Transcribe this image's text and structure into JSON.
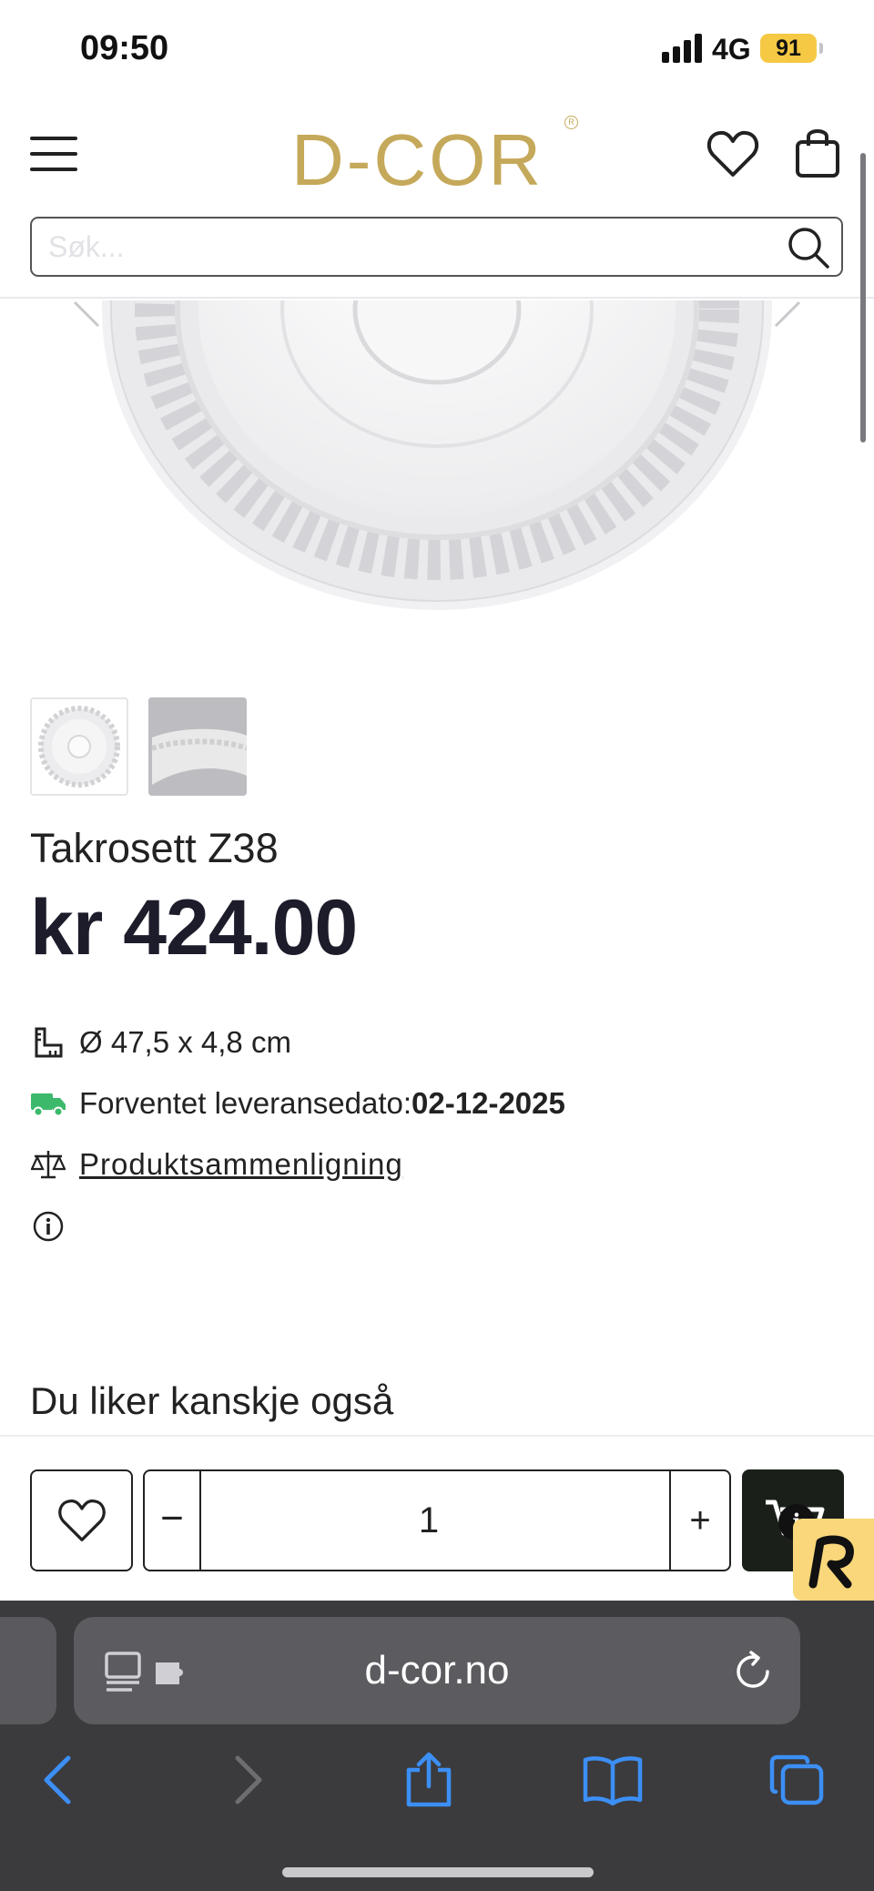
{
  "status_bar": {
    "time": "09:50",
    "network": "4G",
    "battery": "91"
  },
  "header": {
    "logo": "D-COR",
    "search_placeholder": "Søk..."
  },
  "product": {
    "title": "Takrosett Z38",
    "price": "kr 424.00",
    "thumbnails": [
      "Takrosett Z38 front",
      "Takrosett Z38 side"
    ],
    "dimensions": "Ø 47,5 x 4,8 cm",
    "delivery_label": "Forventet leveransedato: ",
    "delivery_date": "02-12-2025",
    "compare_link": "Produktsammenligning"
  },
  "related": {
    "heading": "Du liker kanskje også"
  },
  "buy_bar": {
    "quantity": "1",
    "minus": "−",
    "plus": "+"
  },
  "browser": {
    "url": "d-cor.no"
  },
  "colors": {
    "brand_gold": "#c5a95a",
    "delivery_truck": "#3cb96a",
    "cart_button": "#1a1f1a",
    "browser_bg": "#3b3b3e",
    "safari_blue": "#3c8ff5",
    "reviews_badge": "#f9d77a"
  },
  "icons": {
    "menu": "hamburger-icon",
    "wishlist": "heart-icon",
    "cart": "bag-icon",
    "search": "search-icon",
    "dimensions": "ruler-icon",
    "delivery": "truck-icon",
    "compare": "scale-icon",
    "info": "info-icon"
  }
}
